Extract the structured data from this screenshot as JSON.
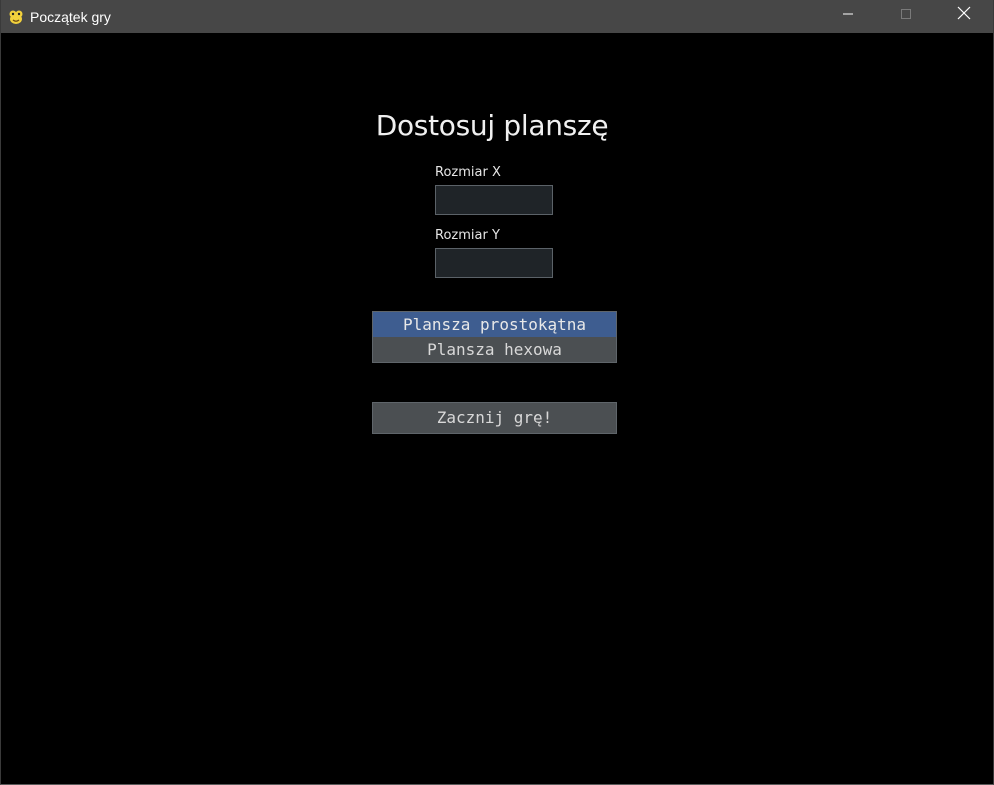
{
  "window": {
    "title": "Początek gry",
    "icon": "python-snake-icon"
  },
  "controls": {
    "minimize_icon": "minimize-icon",
    "maximize_icon": "maximize-icon",
    "close_icon": "close-icon"
  },
  "form": {
    "heading": "Dostosuj planszę",
    "size_x": {
      "label": "Rozmiar X",
      "value": ""
    },
    "size_y": {
      "label": "Rozmiar Y",
      "value": ""
    },
    "board_type": {
      "options": [
        "Plansza prostokątna",
        "Plansza hexowa"
      ],
      "selected": "Plansza prostokątna"
    },
    "start_label": "Zacznij grę!"
  },
  "colors": {
    "background": "#000000",
    "titlebar": "#474747",
    "selected_option": "#3e5d90",
    "button": "#4b4f52",
    "input_bg": "#1f2428"
  }
}
